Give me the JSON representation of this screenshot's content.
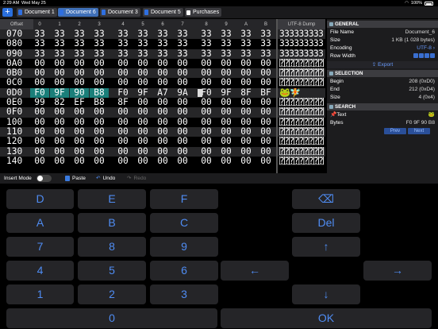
{
  "status": {
    "time": "2:29 AM",
    "day": "Wed May 25",
    "battery": "100%"
  },
  "tabs": [
    {
      "label": "Document 1",
      "active": false
    },
    {
      "label": "Document 6",
      "active": true
    },
    {
      "label": "Document 3",
      "active": false
    },
    {
      "label": "Document 5",
      "active": false
    },
    {
      "label": "Purchases",
      "active": false
    }
  ],
  "hex": {
    "offset_header": "Offset",
    "columns": [
      "0",
      "1",
      "2",
      "3",
      "4",
      "5",
      "6",
      "7",
      "8",
      "9",
      "A",
      "B"
    ],
    "dump_header": "UTF-8 Dump",
    "rows": [
      {
        "offset": "070",
        "bytes": [
          "33",
          "33",
          "33",
          "33",
          "33",
          "33",
          "33",
          "33",
          "33",
          "33",
          "33",
          "33"
        ],
        "dump": "333333333333"
      },
      {
        "offset": "080",
        "bytes": [
          "33",
          "33",
          "33",
          "33",
          "33",
          "33",
          "33",
          "33",
          "33",
          "33",
          "33",
          "33"
        ],
        "dump": "333333333333"
      },
      {
        "offset": "090",
        "bytes": [
          "33",
          "33",
          "33",
          "33",
          "33",
          "33",
          "33",
          "33",
          "33",
          "33",
          "33",
          "33"
        ],
        "dump": "333333333333"
      },
      {
        "offset": "0A0",
        "bytes": [
          "00",
          "00",
          "00",
          "00",
          "00",
          "00",
          "00",
          "00",
          "00",
          "00",
          "00",
          "00"
        ],
        "dump": "⍰⍰⍰⍰⍰⍰⍰⍰⍰⍰⍰⍰"
      },
      {
        "offset": "0B0",
        "bytes": [
          "00",
          "00",
          "00",
          "00",
          "00",
          "00",
          "00",
          "00",
          "00",
          "00",
          "00",
          "00"
        ],
        "dump": "⍰⍰⍰⍰⍰⍰⍰⍰⍰⍰⍰⍰"
      },
      {
        "offset": "0C0",
        "bytes": [
          "00",
          "00",
          "00",
          "00",
          "00",
          "00",
          "00",
          "00",
          "00",
          "00",
          "00",
          "00"
        ],
        "dump": "⍰⍰⍰⍰⍰⍰⍰⍰⍰⍰⍰⍰"
      },
      {
        "offset": "0D0",
        "bytes": [
          "F0",
          "9F",
          "90",
          "B8",
          "F0",
          "9F",
          "A7",
          "9A",
          "F0",
          "9F",
          "8F",
          "BF"
        ],
        "dump": "🐸🧚"
      },
      {
        "offset": "0E0",
        "bytes": [
          "99",
          "82",
          "EF",
          "B8",
          "8F",
          "00",
          "00",
          "00",
          "00",
          "00",
          "00",
          "00"
        ],
        "dump": "⍰⍰⍰⍰⍰⍰⍰⍰⍰⍰⍰⍰"
      },
      {
        "offset": "0F0",
        "bytes": [
          "00",
          "00",
          "00",
          "00",
          "00",
          "00",
          "00",
          "00",
          "00",
          "00",
          "00",
          "00"
        ],
        "dump": "⍰⍰⍰⍰⍰⍰⍰⍰⍰⍰⍰⍰"
      },
      {
        "offset": "100",
        "bytes": [
          "00",
          "00",
          "00",
          "00",
          "00",
          "00",
          "00",
          "00",
          "00",
          "00",
          "00",
          "00"
        ],
        "dump": "⍰⍰⍰⍰⍰⍰⍰⍰⍰⍰⍰⍰"
      },
      {
        "offset": "110",
        "bytes": [
          "00",
          "00",
          "00",
          "00",
          "00",
          "00",
          "00",
          "00",
          "00",
          "00",
          "00",
          "00"
        ],
        "dump": "⍰⍰⍰⍰⍰⍰⍰⍰⍰⍰⍰⍰"
      },
      {
        "offset": "120",
        "bytes": [
          "00",
          "00",
          "00",
          "00",
          "00",
          "00",
          "00",
          "00",
          "00",
          "00",
          "00",
          "00"
        ],
        "dump": "⍰⍰⍰⍰⍰⍰⍰⍰⍰⍰⍰⍰"
      },
      {
        "offset": "130",
        "bytes": [
          "00",
          "00",
          "00",
          "00",
          "00",
          "00",
          "00",
          "00",
          "00",
          "00",
          "00",
          "00"
        ],
        "dump": "⍰⍰⍰⍰⍰⍰⍰⍰⍰⍰⍰⍰"
      },
      {
        "offset": "140",
        "bytes": [
          "00",
          "00",
          "00",
          "00",
          "00",
          "00",
          "00",
          "00",
          "00",
          "00",
          "00",
          "00"
        ],
        "dump": "⍰⍰⍰⍰⍰⍰⍰⍰⍰⍰⍰⍰"
      }
    ]
  },
  "panel": {
    "general": {
      "title": "GENERAL",
      "file_name_label": "File Name",
      "file_name": "Document_6",
      "size_label": "Size",
      "size": "1 KB (1 028 bytes)",
      "encoding_label": "Encoding",
      "encoding": "UTF-8",
      "row_width_label": "Row Width",
      "export_label": "Export"
    },
    "selection": {
      "title": "SELECTION",
      "begin_label": "Begin",
      "begin": "208 (0xD0)",
      "end_label": "End",
      "end": "212 (0xD4)",
      "size_label": "Size",
      "size": "4 (0x4)"
    },
    "search": {
      "title": "SEARCH",
      "text_label": "Text",
      "text_value": "🐸",
      "bytes_label": "Bytes",
      "bytes_value": "F0 9F 90 B8",
      "prev_label": "Prev",
      "next_label": "Next"
    }
  },
  "toolbar": {
    "insert_mode": "Insert Mode",
    "paste": "Paste",
    "undo": "Undo",
    "redo": "Redo"
  },
  "keyboard": {
    "rows": [
      [
        "D",
        "E",
        "F",
        "⌫"
      ],
      [
        "A",
        "B",
        "C",
        "Del"
      ],
      [
        "7",
        "8",
        "9",
        "↑"
      ],
      [
        "4",
        "5",
        "6",
        "←",
        "→"
      ],
      [
        "1",
        "2",
        "3",
        "↓"
      ],
      [
        "0",
        "OK"
      ]
    ]
  }
}
